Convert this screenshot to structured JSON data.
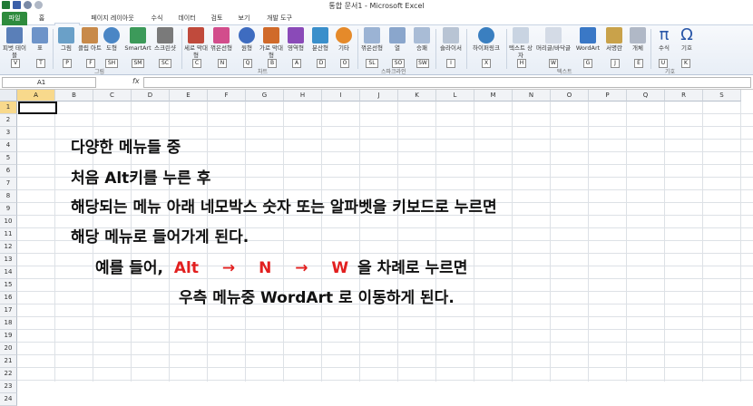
{
  "window_title": "통합 문서1 - Microsoft Excel",
  "tabs": [
    "파일",
    "홈",
    "삽입",
    "페이지 레이아웃",
    "수식",
    "데이터",
    "검토",
    "보기",
    "개발 도구"
  ],
  "ribbon": {
    "buttons": [
      "피벗 테이블",
      "표",
      "그림",
      "클립 아트",
      "도형",
      "SmartArt",
      "스크린샷",
      "세로 막대형",
      "꺾은선형",
      "원형",
      "가로 막대형",
      "영역형",
      "분산형",
      "기타",
      "꺾은선형",
      "열",
      "승패",
      "슬라이서",
      "하이퍼링크",
      "텍스트 상자",
      "머리글/바닥글",
      "WordArt",
      "서명란",
      "개체",
      "수식",
      "기호"
    ],
    "keytips": [
      "V",
      "T",
      "P",
      "F",
      "SH",
      "SM",
      "SC",
      "C",
      "N",
      "Q",
      "B",
      "A",
      "D",
      "O",
      "SL",
      "SO",
      "SW",
      "I",
      "X",
      "H",
      "W",
      "G",
      "J",
      "E",
      "U",
      "K"
    ],
    "groups": [
      "그림",
      "차트",
      "스파크라인",
      "텍스트",
      "기호"
    ]
  },
  "name_box": "A1",
  "fx": "fx",
  "columns": [
    "A",
    "B",
    "C",
    "D",
    "E",
    "F",
    "G",
    "H",
    "I",
    "J",
    "K",
    "L",
    "M",
    "N",
    "O",
    "P",
    "Q",
    "R",
    "S"
  ],
  "rows": [
    "1",
    "2",
    "3",
    "4",
    "5",
    "6",
    "7",
    "8",
    "9",
    "10",
    "11",
    "12",
    "13",
    "14",
    "15",
    "16",
    "17",
    "18",
    "19",
    "20",
    "21",
    "22",
    "23",
    "24"
  ],
  "text": {
    "line1": "다양한 메뉴들 중",
    "line2": "처음 Alt키를 누른 후",
    "line3": "해당되는 메뉴 아래 네모박스 숫자 또는 알파벳을 키보드로 누르면",
    "line4": "해당 메뉴로 들어가게 된다.",
    "line5a": "예를 들어,",
    "alt": "Alt",
    "arrow1": "→",
    "n": "N",
    "arrow2": "→",
    "w": "W",
    "line5b": "을 차례로 누르면",
    "line6": "우측 메뉴중 WordArt 로 이동하게 된다."
  },
  "colors": {
    "accent_red": "#e21f1f",
    "file_tab": "#2e8b3d",
    "selection": "#f8d98c"
  }
}
